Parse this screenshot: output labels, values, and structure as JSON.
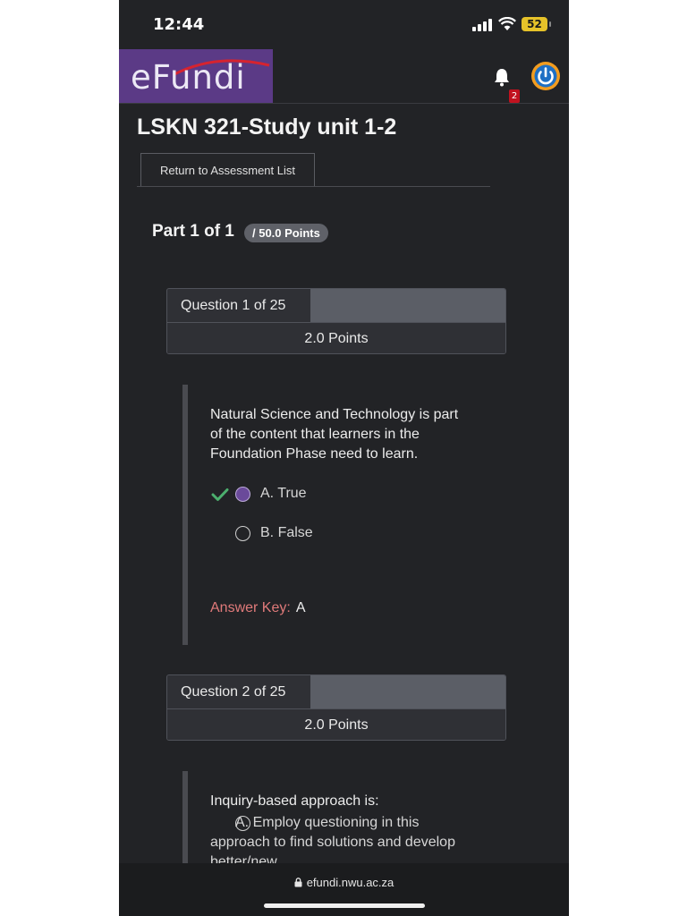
{
  "status_bar": {
    "time": "12:44",
    "battery": "52"
  },
  "header": {
    "logo": "eFundi",
    "notification_count": "2",
    "brand_color": "#5b3a86"
  },
  "page": {
    "title": "LSKN 321-Study unit 1-2",
    "return_button": "Return to Assessment List",
    "part_title": "Part 1 of 1",
    "part_points": "/ 50.0 Points"
  },
  "questions": [
    {
      "label": "Question 1 of 25",
      "points": "2.0 Points",
      "text": "Natural Science and Technology is part of the content that learners in the Foundation Phase need to learn.",
      "options": [
        {
          "label": "A. True",
          "selected": true,
          "correct": true
        },
        {
          "label": "B. False",
          "selected": false
        }
      ],
      "answer_key_label": "Answer Key:",
      "answer_key_value": "A"
    },
    {
      "label": "Question 2 of 25",
      "points": "2.0 Points",
      "text": "Inquiry-based approach is:",
      "options": [
        {
          "label": "A. Employ questioning in this approach to find solutions and develop better/new",
          "selected": false
        }
      ]
    }
  ],
  "browser": {
    "url": "efundi.nwu.ac.za"
  },
  "colors": {
    "background": "#222326",
    "answer_key": "#e07a7a",
    "check": "#4caf6e"
  }
}
